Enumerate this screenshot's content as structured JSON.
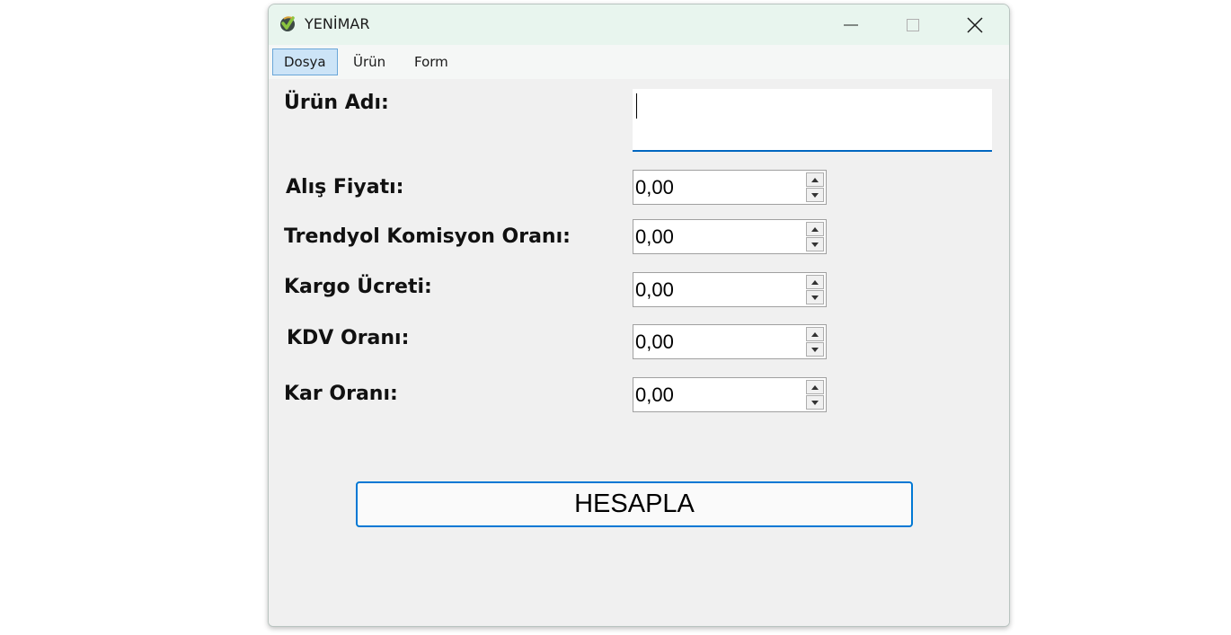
{
  "window": {
    "title": "YENİMAR",
    "icon": "yenimar-logo-icon",
    "controls": [
      "minimize-icon",
      "maximize-icon",
      "close-icon"
    ]
  },
  "menu": {
    "items": [
      {
        "label": "Dosya",
        "active": true
      },
      {
        "label": "Ürün",
        "active": false
      },
      {
        "label": "Form",
        "active": false
      }
    ]
  },
  "form": {
    "product_name": {
      "label": "Ürün Adı:",
      "value": ""
    },
    "purchase_price": {
      "label": "Alış Fiyatı:",
      "value": "0,00"
    },
    "commission_rate": {
      "label": "Trendyol Komisyon Oranı:",
      "value": "0,00"
    },
    "shipping_fee": {
      "label": "Kargo Ücreti:",
      "value": "0,00"
    },
    "vat_rate": {
      "label": "KDV Oranı:",
      "value": "0,00"
    },
    "profit_rate": {
      "label": "Kar Oranı:",
      "value": "0,00"
    }
  },
  "actions": {
    "calculate_label": "HESAPLA"
  },
  "colors": {
    "titlebar": "#e8f5ee",
    "accent": "#0078d4",
    "menu_active": "#cce4f7",
    "background": "#f0f0f0"
  }
}
